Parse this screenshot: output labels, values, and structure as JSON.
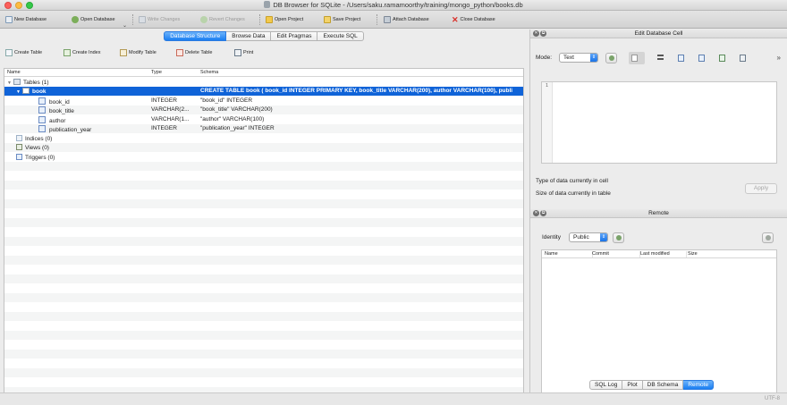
{
  "window": {
    "title": "DB Browser for SQLite - /Users/saku.ramamoorthy/training/mongo_python/books.db"
  },
  "toolbar": {
    "new_database": "New Database",
    "open_database": "Open Database",
    "write_changes": "Write Changes",
    "revert_changes": "Revert Changes",
    "open_project": "Open Project",
    "save_project": "Save Project",
    "attach_database": "Attach Database",
    "close_database": "Close Database"
  },
  "tabs": [
    "Database Structure",
    "Browse Data",
    "Edit Pragmas",
    "Execute SQL"
  ],
  "structure_toolbar": {
    "create_table": "Create Table",
    "create_index": "Create Index",
    "modify_table": "Modify Table",
    "delete_table": "Delete Table",
    "print": "Print"
  },
  "tree": {
    "headers": {
      "name": "Name",
      "type": "Type",
      "schema": "Schema"
    },
    "tables_group": "Tables (1)",
    "table": {
      "name": "book",
      "schema": "CREATE TABLE book ( book_id INTEGER PRIMARY KEY, book_title VARCHAR(200), author VARCHAR(100), publi"
    },
    "fields": [
      {
        "name": "book_id",
        "type": "INTEGER",
        "schema": "\"book_id\" INTEGER"
      },
      {
        "name": "book_title",
        "type": "VARCHAR(2...",
        "schema": "\"book_title\" VARCHAR(200)"
      },
      {
        "name": "author",
        "type": "VARCHAR(1...",
        "schema": "\"author\" VARCHAR(100)"
      },
      {
        "name": "publication_year",
        "type": "INTEGER",
        "schema": "\"publication_year\" INTEGER"
      }
    ],
    "indices": "Indices (0)",
    "views": "Views (0)",
    "triggers": "Triggers (0)"
  },
  "edit_cell": {
    "title": "Edit Database Cell",
    "mode_label": "Mode:",
    "mode_value": "Text",
    "line_number": "1",
    "type_info": "Type of data currently in cell",
    "size_info": "Size of data currently in table",
    "apply": "Apply"
  },
  "remote": {
    "title": "Remote",
    "identity_label": "Identity",
    "identity_value": "Public",
    "columns": [
      "Name",
      "Commit",
      "Last modified",
      "Size"
    ]
  },
  "bottom_tabs": [
    "SQL Log",
    "Plot",
    "DB Schema",
    "Remote"
  ],
  "status": {
    "encoding": "UTF-8"
  }
}
